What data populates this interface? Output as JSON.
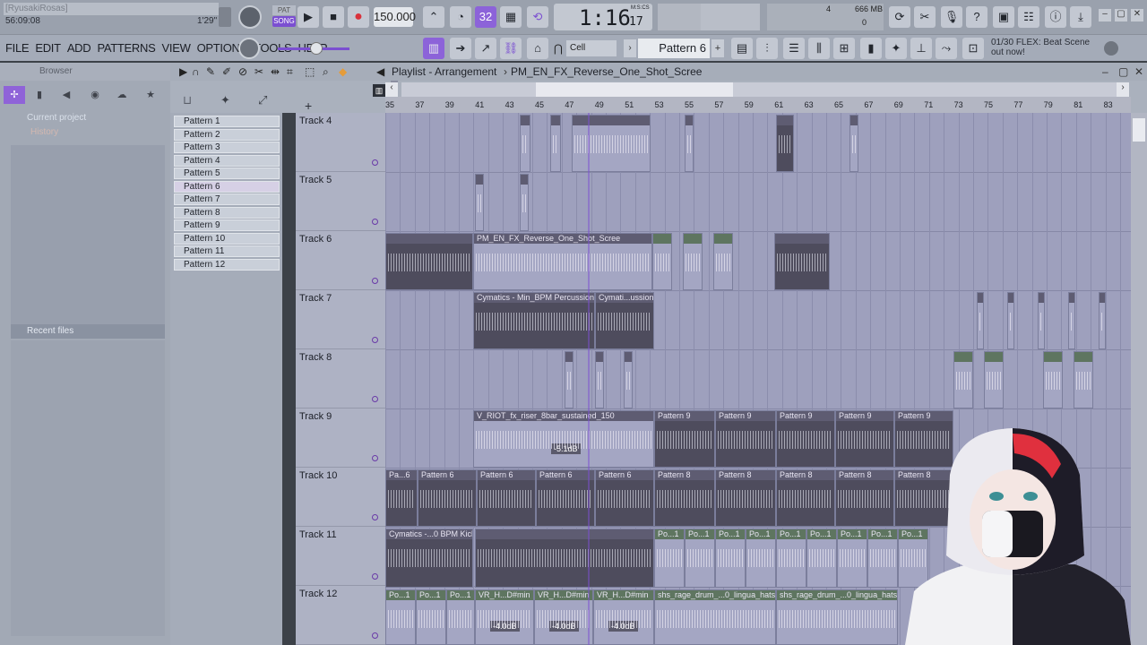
{
  "topbar": {
    "user": "[RyusakiRosas]",
    "time_elapsed": "56:09:08",
    "song_pos_small": "1'29\"",
    "mode": "SONG",
    "tempo": "150.000",
    "transport_time": "1:16",
    "transport_ticks": "17",
    "transport_unit": "M:S:CS",
    "memory": "666 MB",
    "cpu_num": "4",
    "poly": "0"
  },
  "menu": [
    "FILE",
    "EDIT",
    "ADD",
    "PATTERNS",
    "VIEW",
    "OPTIONS",
    "TOOLS",
    "HELP"
  ],
  "toolbar": {
    "snap": "Cell",
    "pattern": "Pattern 6",
    "news_count": "01/30",
    "news_title": "FLEX: Beat Scene",
    "news_sub": "out now!"
  },
  "browser": {
    "title": "Browser",
    "items": [
      "Current project",
      "History"
    ],
    "recent": "Recent files"
  },
  "playlist": {
    "title": "Playlist - Arrangement",
    "breadcrumb": "PM_EN_FX_Reverse_One_Shot_Scree",
    "ruler": [
      "35",
      "37",
      "39",
      "41",
      "43",
      "45",
      "47",
      "49",
      "51",
      "53",
      "55",
      "57",
      "59",
      "61",
      "63",
      "65",
      "67",
      "69",
      "71",
      "73",
      "75",
      "77",
      "79",
      "81",
      "83"
    ]
  },
  "patterns": [
    "Pattern 1",
    "Pattern 2",
    "Pattern 3",
    "Pattern 4",
    "Pattern 5",
    "Pattern 6",
    "Pattern 7",
    "Pattern 8",
    "Pattern 9",
    "Pattern 10",
    "Pattern 11",
    "Pattern 12"
  ],
  "selected_pattern": 5,
  "tracks": [
    "Track 4",
    "Track 5",
    "Track 6",
    "Track 7",
    "Track 8",
    "Track 9",
    "Track 10",
    "Track 11",
    "Track 12"
  ],
  "clips": {
    "t6_main": "PM_EN_FX_Reverse_One_Shot_Scree",
    "t7_a": "Cymatics - Min_BPM Percussion",
    "t7_b": "Cymati...ussion",
    "t9_main": "V_RIOT_fx_riser_8bar_sustained_150",
    "t9_db": "-5.1dB",
    "t9_p": "Pattern 9",
    "t10_p6": "Pattern 6",
    "t10_p8": "Pattern 8",
    "t10_first": "Pa...6",
    "t11_main": "Cymatics -...0 BPM Kick",
    "t11_po": "Po...1",
    "t12_po": "Po...1",
    "t12_vr": "VR_H...D#min",
    "t12_db": "-4.0dB",
    "t12_shs": "shs_rage_drum_...0_lingua_hats"
  },
  "colors": {
    "accent": "#7b4fd1",
    "record": "#d9323c",
    "grid_bg": "#9ea0bd"
  }
}
